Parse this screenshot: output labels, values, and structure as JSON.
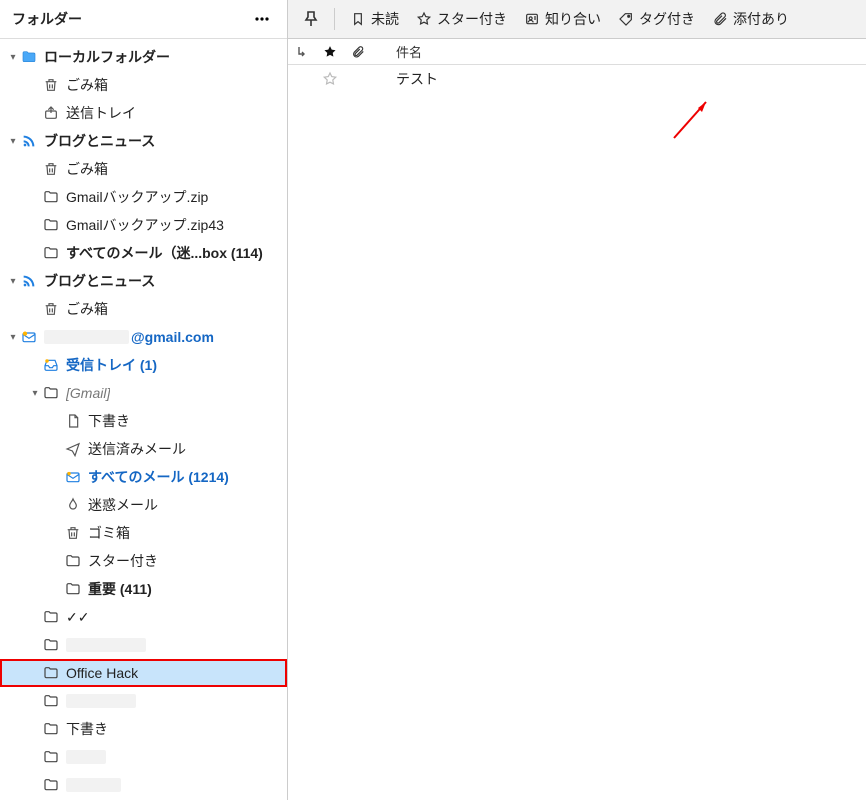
{
  "sidebar": {
    "title": "フォルダー",
    "tree": [
      {
        "label": "ローカルフォルダー",
        "icon": "folder-blue",
        "indent": 0,
        "twisty": "down",
        "bold": true
      },
      {
        "label": "ごみ箱",
        "icon": "trash",
        "indent": 1
      },
      {
        "label": "送信トレイ",
        "icon": "outbox",
        "indent": 1
      },
      {
        "label": "ブログとニュース",
        "icon": "rss",
        "indent": 0,
        "twisty": "down",
        "bold": true
      },
      {
        "label": "ごみ箱",
        "icon": "trash",
        "indent": 1
      },
      {
        "label": "Gmailバックアップ.zip",
        "icon": "folder",
        "indent": 1
      },
      {
        "label": "Gmailバックアップ.zip43",
        "icon": "folder",
        "indent": 1
      },
      {
        "label": "すべてのメール（迷...box (114)",
        "icon": "folder",
        "indent": 1,
        "bold": true
      },
      {
        "label": "ブログとニュース",
        "icon": "rss",
        "indent": 0,
        "twisty": "down",
        "bold": true
      },
      {
        "label": "ごみ箱",
        "icon": "trash",
        "indent": 1
      },
      {
        "label": "@gmail.com",
        "icon": "mail-account",
        "indent": 0,
        "twisty": "down",
        "bold": true,
        "accent": true,
        "redactedPrefix": true
      },
      {
        "label": "受信トレイ (1)",
        "icon": "inbox",
        "indent": 1,
        "bold": true,
        "accent": true
      },
      {
        "label": "[Gmail]",
        "icon": "folder",
        "indent": 1,
        "twisty": "down",
        "italic": true
      },
      {
        "label": "下書き",
        "icon": "draft",
        "indent": 2
      },
      {
        "label": "送信済みメール",
        "icon": "sent",
        "indent": 2
      },
      {
        "label": "すべてのメール (1214)",
        "icon": "allmail",
        "indent": 2,
        "bold": true,
        "accent": true
      },
      {
        "label": "迷惑メール",
        "icon": "spam",
        "indent": 2
      },
      {
        "label": "ゴミ箱",
        "icon": "trash",
        "indent": 2
      },
      {
        "label": "スター付き",
        "icon": "folder",
        "indent": 2
      },
      {
        "label": "重要 (411)",
        "icon": "folder",
        "indent": 2,
        "bold": true
      },
      {
        "label": "✓✓",
        "icon": "folder",
        "indent": 1
      },
      {
        "label": "",
        "icon": "folder",
        "indent": 1,
        "redactedLabel": true,
        "redactWidth": 80
      },
      {
        "label": "Office Hack",
        "icon": "folder",
        "indent": 1,
        "selected": true,
        "redOutline": true
      },
      {
        "label": "",
        "icon": "folder",
        "indent": 1,
        "redactedLabel": true,
        "redactWidth": 70
      },
      {
        "label": "下書き",
        "icon": "folder",
        "indent": 1
      },
      {
        "label": "",
        "icon": "folder",
        "indent": 1,
        "redactedLabel": true,
        "redactWidth": 40
      },
      {
        "label": "",
        "icon": "folder",
        "indent": 1,
        "redactedLabel": true,
        "redactWidth": 55
      }
    ]
  },
  "toolbar": {
    "pin": "",
    "filters": [
      {
        "icon": "bookmark",
        "label": "未読"
      },
      {
        "icon": "star",
        "label": "スター付き"
      },
      {
        "icon": "contact",
        "label": "知り合い"
      },
      {
        "icon": "tag",
        "label": "タグ付き"
      },
      {
        "icon": "attach",
        "label": "添付あり"
      }
    ]
  },
  "listHeader": {
    "subject": "件名"
  },
  "messages": [
    {
      "subject": "テスト",
      "starred": false
    }
  ]
}
